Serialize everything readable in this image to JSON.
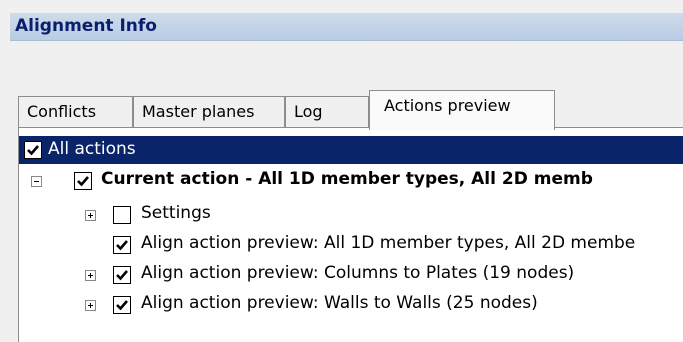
{
  "window": {
    "title": "Alignment Info"
  },
  "tabs": [
    {
      "label": "Conflicts",
      "active": false
    },
    {
      "label": "Master planes",
      "active": false
    },
    {
      "label": "Log",
      "active": false
    },
    {
      "label": "Actions preview",
      "active": true
    }
  ],
  "tree": {
    "root": {
      "label": "All actions",
      "checked": true,
      "selected": true
    },
    "current_action": {
      "label": "Current action - All 1D member types, All 2D memb",
      "checked": true,
      "expanded": true
    },
    "items": [
      {
        "label": "Settings",
        "checked": false,
        "expandable": true
      },
      {
        "label": "Align action preview: All 1D member types, All 2D membe",
        "checked": true,
        "expandable": false
      },
      {
        "label": "Align action preview: Columns to Plates (19 nodes)",
        "checked": true,
        "expandable": true
      },
      {
        "label": "Align action preview: Walls to Walls (25 nodes)",
        "checked": true,
        "expandable": true
      }
    ]
  },
  "icons": {
    "checkbox": "checkbox-icon",
    "expander": "expand-collapse-icon"
  },
  "colors": {
    "selection": "#0a246a",
    "title_text": "#0a1e6e"
  }
}
